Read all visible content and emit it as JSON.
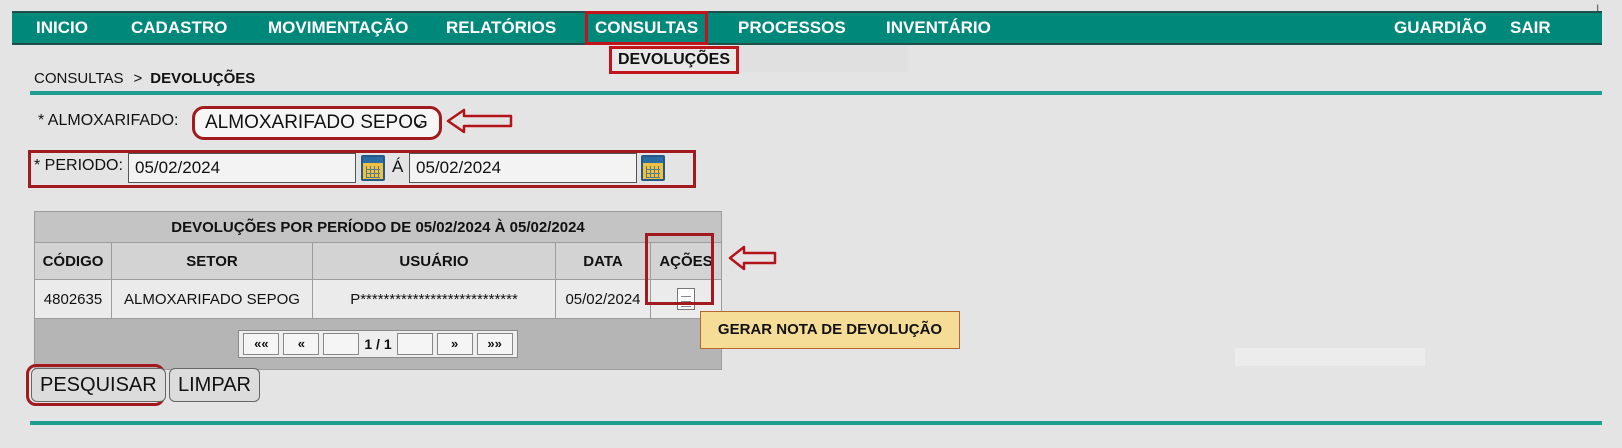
{
  "nav": {
    "items": [
      "INICIO",
      "CADASTRO",
      "MOVIMENTAÇÃO",
      "RELATÓRIOS",
      "CONSULTAS",
      "PROCESSOS",
      "INVENTÁRIO"
    ],
    "right_items": [
      "GUARDIÃO",
      "SAIR"
    ],
    "active": "CONSULTAS",
    "submenu_item": "DEVOLUÇÕES"
  },
  "breadcrumb": {
    "parent": "CONSULTAS",
    "separator": ">",
    "current": "DEVOLUÇÕES"
  },
  "form": {
    "almoxarifado_label": "* ALMOXARIFADO:",
    "almoxarifado_value": "ALMOXARIFADO SEPOG",
    "periodo_label": "* PERIODO:",
    "date_start": "05/02/2024",
    "date_separator": "Á",
    "date_end": "05/02/2024"
  },
  "table": {
    "title": "DEVOLUÇÕES POR PERÍODO DE 05/02/2024 À 05/02/2024",
    "columns": [
      "CÓDIGO",
      "SETOR",
      "USUÁRIO",
      "DATA",
      "AÇÕES"
    ],
    "rows": [
      {
        "codigo": "4802635",
        "setor": "ALMOXARIFADO SEPOG",
        "usuario": "P***************************",
        "data": "05/02/2024",
        "acao_icon": "document-icon"
      }
    ],
    "pager": {
      "first": "««",
      "prev": "«",
      "page_info": "1 / 1",
      "next": "»",
      "last": "»»"
    }
  },
  "tooltip": "GERAR NOTA DE DEVOLUÇÃO",
  "buttons": {
    "search": "PESQUISAR",
    "clear": "LIMPAR"
  },
  "colors": {
    "nav_bg": "#00897a",
    "highlight": "#a01a1e",
    "rule": "#1d9e90",
    "tooltip_bg": "#f5dd97"
  }
}
